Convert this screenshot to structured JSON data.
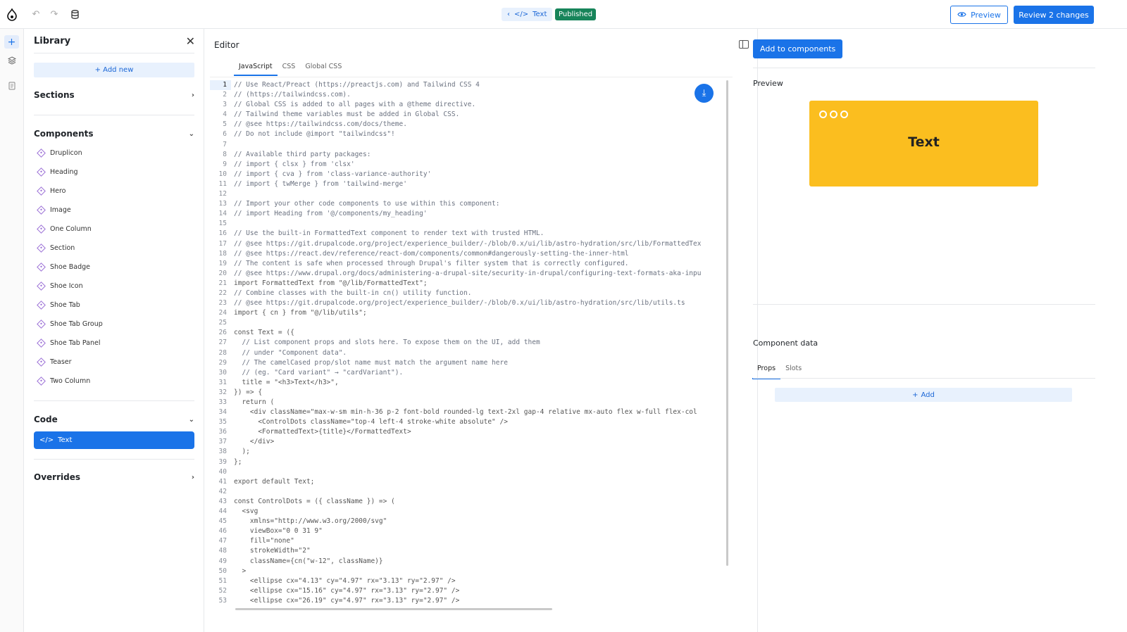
{
  "topbar": {
    "chip_text": "Text",
    "status": "Published",
    "preview_label": "Preview",
    "review_label": "Review 2 changes"
  },
  "library": {
    "title": "Library",
    "add_new": "Add new",
    "sections_label": "Sections",
    "components_label": "Components",
    "components": [
      "Druplicon",
      "Heading",
      "Hero",
      "Image",
      "One Column",
      "Section",
      "Shoe Badge",
      "Shoe Icon",
      "Shoe Tab",
      "Shoe Tab Group",
      "Shoe Tab Panel",
      "Teaser",
      "Two Column"
    ],
    "code_label": "Code",
    "code_item": "Text",
    "overrides_label": "Overrides"
  },
  "editor": {
    "title": "Editor",
    "tabs": [
      "JavaScript",
      "CSS",
      "Global CSS"
    ],
    "active_tab": "JavaScript",
    "code_lines": [
      "// Use React/Preact (https://preactjs.com) and Tailwind CSS 4",
      "// (https://tailwindcss.com).",
      "// Global CSS is added to all pages with a @theme directive.",
      "// Tailwind theme variables must be added in Global CSS.",
      "// @see https://tailwindcss.com/docs/theme.",
      "// Do not include @import \"tailwindcss\"!",
      "",
      "// Available third party packages:",
      "// import { clsx } from 'clsx'",
      "// import { cva } from 'class-variance-authority'",
      "// import { twMerge } from 'tailwind-merge'",
      "",
      "// Import your other code components to use within this component:",
      "// import Heading from '@/components/my_heading'",
      "",
      "// Use the built-in FormattedText component to render text with trusted HTML.",
      "// @see https://git.drupalcode.org/project/experience_builder/-/blob/0.x/ui/lib/astro-hydration/src/lib/FormattedTex",
      "// @see https://react.dev/reference/react-dom/components/common#dangerously-setting-the-inner-html",
      "// The content is safe when processed through Drupal's filter system that is correctly configured.",
      "// @see https://www.drupal.org/docs/administering-a-drupal-site/security-in-drupal/configuring-text-formats-aka-inpu",
      "import FormattedText from \"@/lib/FormattedText\";",
      "// Combine classes with the built-in cn() utility function.",
      "// @see https://git.drupalcode.org/project/experience_builder/-/blob/0.x/ui/lib/astro-hydration/src/lib/utils.ts",
      "import { cn } from \"@/lib/utils\";",
      "",
      "const Text = ({",
      "  // List component props and slots here. To expose them on the UI, add them",
      "  // under \"Component data\".",
      "  // The camelCased prop/slot name must match the argument name here",
      "  // (eg. \"Card variant\" → \"cardVariant\").",
      "  title = \"<h3>Text</h3>\",",
      "}) => {",
      "  return (",
      "    <div className=\"max-w-sm min-h-36 p-2 font-bold rounded-lg text-2xl gap-4 relative mx-auto flex w-full flex-col",
      "      <ControlDots className=\"top-4 left-4 stroke-white absolute\" />",
      "      <FormattedText>{title}</FormattedText>",
      "    </div>",
      "  );",
      "};",
      "",
      "export default Text;",
      "",
      "const ControlDots = ({ className }) => (",
      "  <svg",
      "    xmlns=\"http://www.w3.org/2000/svg\"",
      "    viewBox=\"0 0 31 9\"",
      "    fill=\"none\"",
      "    strokeWidth=\"2\"",
      "    className={cn(\"w-12\", className)}",
      "  >",
      "    <ellipse cx=\"4.13\" cy=\"4.97\" rx=\"3.13\" ry=\"2.97\" />",
      "    <ellipse cx=\"15.16\" cy=\"4.97\" rx=\"3.13\" ry=\"2.97\" />",
      "    <ellipse cx=\"26.19\" cy=\"4.97\" rx=\"3.13\" ry=\"2.97\" />"
    ]
  },
  "right": {
    "add_to_components": "Add to components",
    "preview_label": "Preview",
    "card_text": "Text",
    "card_color": "#fbbe1f",
    "component_data_label": "Component data",
    "tabs": [
      "Props",
      "Slots"
    ],
    "active_tab": "Props",
    "add_label": "Add"
  }
}
